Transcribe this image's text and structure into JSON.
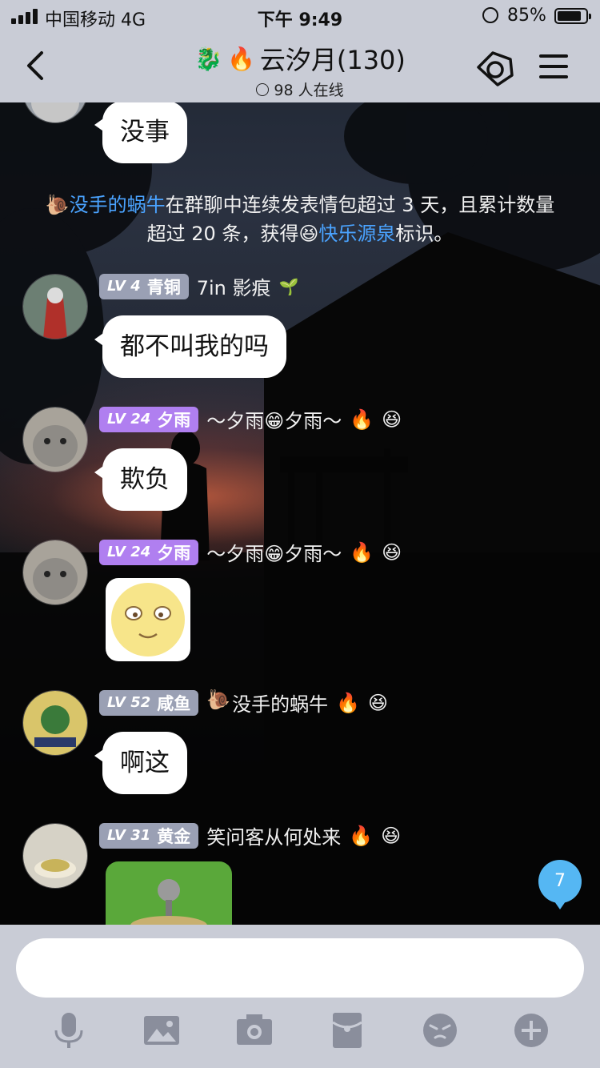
{
  "status_bar": {
    "carrier": "中国移动  4G",
    "time": "下午 9:49",
    "battery_percent": "85%",
    "battery_level": 0.85
  },
  "header": {
    "title": "云汐月(130)",
    "title_emojis": [
      "🐉",
      "🔥"
    ],
    "online": "98 人在线",
    "icons": [
      "back-icon",
      "tag-icon",
      "menu-icon"
    ]
  },
  "chat": {
    "messages": [
      {
        "type": "text",
        "text": "没事"
      },
      {
        "type": "system",
        "user": "没手的蜗牛",
        "line1_mid": "在群聊中连续发表情包超过 3 天，且累计数量",
        "line2_pre": "超过 20 条，获得",
        "badge_name": "快乐源泉",
        "line2_post": "标识。"
      },
      {
        "type": "text",
        "level": "LV 4",
        "rank": "青铜",
        "name": "7in 影痕",
        "name_emoji": "🌱",
        "text": "都不叫我的吗"
      },
      {
        "type": "text",
        "level": "LV 24",
        "rank": "夕雨",
        "name": "～夕雨😁夕雨～",
        "badges": [
          "🔥",
          "😆"
        ],
        "text": "欺负"
      },
      {
        "type": "sticker",
        "level": "LV 24",
        "rank": "夕雨",
        "name": "～夕雨😁夕雨～",
        "badges": [
          "🔥",
          "😆"
        ],
        "sticker": "smile-face-sticker"
      },
      {
        "type": "text",
        "level": "LV 52",
        "rank": "咸鱼",
        "name": "没手的蜗牛",
        "name_emoji": "🐌",
        "badges": [
          "🔥",
          "😆"
        ],
        "text": "啊这"
      },
      {
        "type": "sticker",
        "level": "LV 31",
        "rank": "黄金",
        "name": "笑问客从何处来",
        "badges": [
          "🔥",
          "😆"
        ],
        "sticker": "green-sticker"
      }
    ],
    "unread_count": "7"
  },
  "input": {
    "value": "",
    "tools": [
      "microphone-icon",
      "image-icon",
      "camera-icon",
      "red-packet-icon",
      "emoji-icon",
      "plus-icon"
    ]
  },
  "colors": {
    "bar_bg": "#c9ccd6",
    "link": "#4aa3ff",
    "level_gray": "#9aa0b4",
    "level_purple": "#b07ff0",
    "unread": "#55b7f3"
  }
}
